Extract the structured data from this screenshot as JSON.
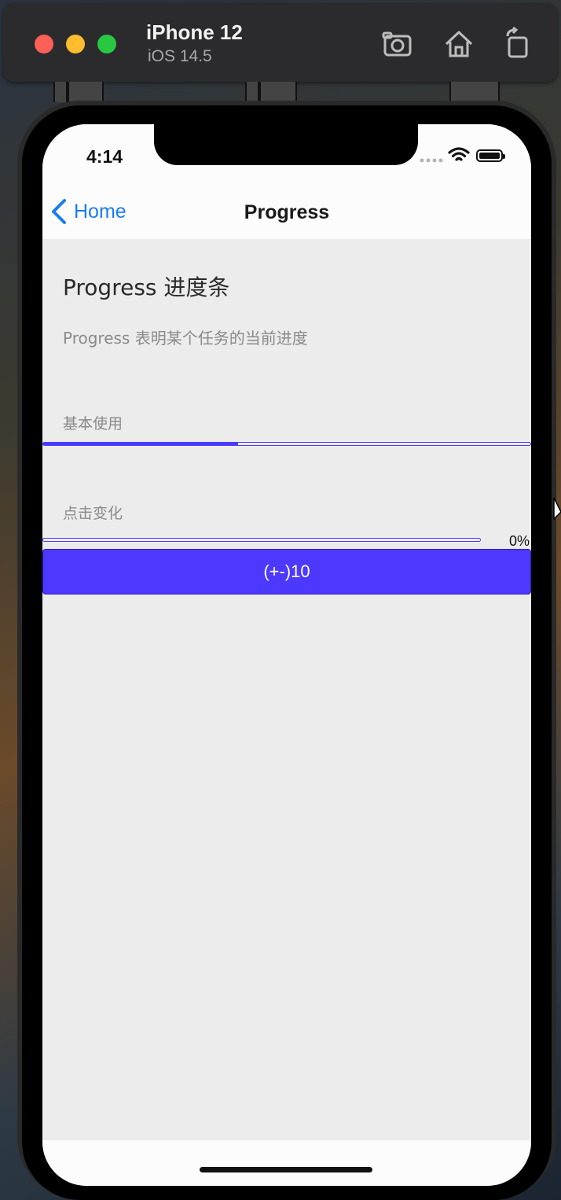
{
  "simulator": {
    "device_name": "iPhone 12",
    "os_version": "iOS 14.5",
    "icons": [
      "screenshot-icon",
      "home-icon",
      "rotate-icon"
    ]
  },
  "status_bar": {
    "time": "4:14",
    "icons": [
      "wifi-icon",
      "battery-icon"
    ]
  },
  "nav": {
    "back_label": "Home",
    "title": "Progress"
  },
  "page": {
    "title": "Progress 进度条",
    "description": "Progress 表明某个任务的当前进度"
  },
  "sections": [
    {
      "label": "基本使用",
      "progress_percent": 40
    },
    {
      "label": "点击变化",
      "progress_percent": 0,
      "value_text": "0%",
      "button_label": "(+-)10"
    }
  ],
  "colors": {
    "accent": "#4d38ff",
    "ios_blue": "#1a7cf5",
    "background": "#ececec"
  }
}
